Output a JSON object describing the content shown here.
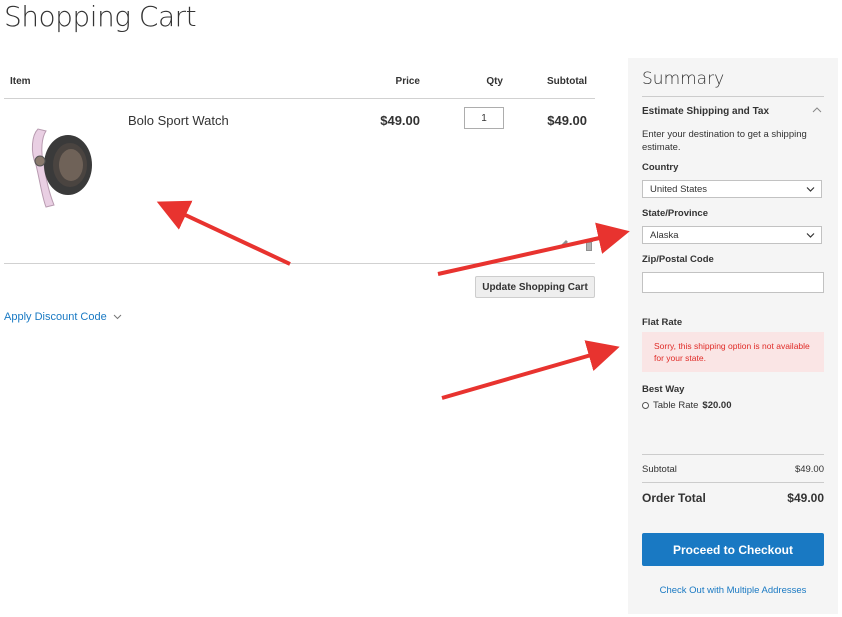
{
  "page": {
    "title": "Shopping Cart"
  },
  "cart": {
    "headers": {
      "item": "Item",
      "price": "Price",
      "qty": "Qty",
      "subtotal": "Subtotal"
    },
    "items": [
      {
        "name": "Bolo Sport Watch",
        "price": "$49.00",
        "qty": "1",
        "subtotal": "$49.00"
      }
    ],
    "update_label": "Update Shopping Cart",
    "discount_label": "Apply Discount Code"
  },
  "summary": {
    "title": "Summary",
    "estimate_title": "Estimate Shipping and Tax",
    "estimate_desc": "Enter your destination to get a shipping estimate.",
    "country_label": "Country",
    "country_value": "United States",
    "state_label": "State/Province",
    "state_value": "Alaska",
    "zip_label": "Zip/Postal Code",
    "zip_value": "",
    "flat_rate_label": "Flat Rate",
    "flat_rate_error": "Sorry, this shipping option is not available for your state.",
    "best_way_label": "Best Way",
    "table_rate_label": "Table Rate",
    "table_rate_price": "$20.00",
    "subtotal_label": "Subtotal",
    "subtotal_value": "$49.00",
    "order_total_label": "Order Total",
    "order_total_value": "$49.00",
    "checkout_label": "Proceed to Checkout",
    "multi_label": "Check Out with Multiple Addresses"
  },
  "colors": {
    "accent": "#1979c3",
    "error_bg": "#fae5e5",
    "error_text": "#e02b27",
    "annotation": "#e8332f"
  },
  "icons": [
    "edit-icon",
    "trash-icon",
    "chevron-down-icon",
    "chevron-up-icon"
  ]
}
